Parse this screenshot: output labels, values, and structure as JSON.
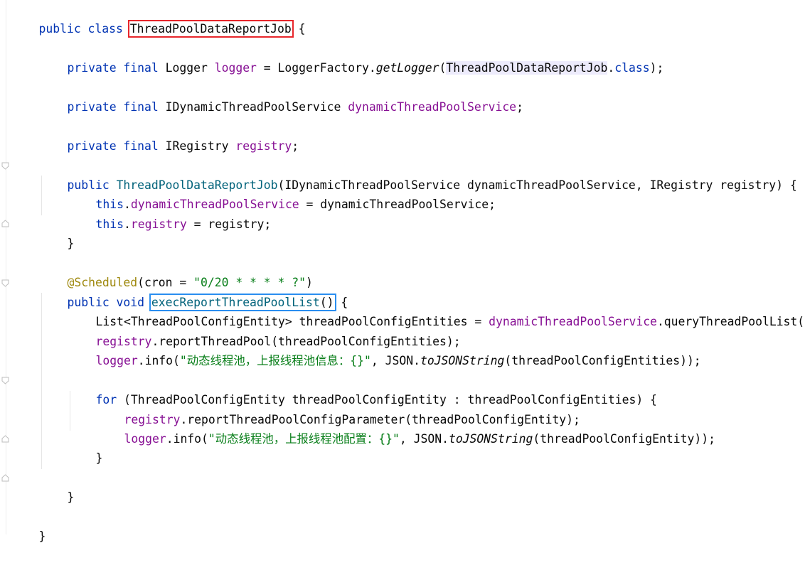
{
  "colors": {
    "keyword": "#0033b3",
    "field": "#871094",
    "string": "#067d17",
    "annotation": "#9e880d",
    "highlight_red": "#e8262b",
    "highlight_blue": "#2a8ef0"
  },
  "code": {
    "l1": {
      "kw": "public class ",
      "cls": "ThreadPoolDataReportJob",
      "rest": " {"
    },
    "l2": {
      "kw": "private final ",
      "t": "Logger ",
      "fld": "logger",
      "a": " = LoggerFactory.",
      "m": "getLogger",
      "b": "(",
      "ref": "ThreadPoolDataReportJob",
      "c": ".",
      "kw2": "class",
      "d": ");"
    },
    "l3": {
      "kw": "private final ",
      "t": "IDynamicThreadPoolService ",
      "fld": "dynamicThreadPoolService",
      "rest": ";"
    },
    "l4": {
      "kw": "private final ",
      "t": "IRegistry ",
      "fld": "registry",
      "rest": ";"
    },
    "l5": {
      "kw": "public ",
      "ctor": "ThreadPoolDataReportJob",
      "rest": "(IDynamicThreadPoolService dynamicThreadPoolService, IRegistry registry) {"
    },
    "l6": {
      "kw": "this",
      "a": ".",
      "fld": "dynamicThreadPoolService",
      "rest": " = dynamicThreadPoolService;"
    },
    "l7": {
      "kw": "this",
      "a": ".",
      "fld": "registry",
      "rest": " = registry;"
    },
    "l8": {
      "rest": "}"
    },
    "l9": {
      "ann": "@Scheduled",
      "a": "(cron = ",
      "str": "\"0/20 * * * * ?\"",
      "b": ")"
    },
    "l10": {
      "kw": "public void ",
      "method": "execReportThreadPoolList",
      "paren": "()",
      "rest": " {"
    },
    "l11": {
      "a": "List<ThreadPoolConfigEntity> threadPoolConfigEntities = ",
      "fld": "dynamicThreadPoolService",
      "rest": ".queryThreadPoolList();"
    },
    "l12": {
      "fld": "registry",
      "rest": ".reportThreadPool(threadPoolConfigEntities);"
    },
    "l13": {
      "fld": "logger",
      "a": ".info(",
      "str": "\"动态线程池，上报线程池信息：{}\"",
      "b": ", JSON.",
      "m": "toJSONString",
      "rest": "(threadPoolConfigEntities));"
    },
    "l14": {
      "kw": "for",
      "rest": " (ThreadPoolConfigEntity threadPoolConfigEntity : threadPoolConfigEntities) {"
    },
    "l15": {
      "fld": "registry",
      "rest": ".reportThreadPoolConfigParameter(threadPoolConfigEntity);"
    },
    "l16": {
      "fld": "logger",
      "a": ".info(",
      "str": "\"动态线程池，上报线程池配置：{}\"",
      "b": ", JSON.",
      "m": "toJSONString",
      "rest": "(threadPoolConfigEntity));"
    },
    "l17": {
      "rest": "}"
    },
    "l18": {
      "rest": "}"
    },
    "l19": {
      "rest": "}"
    }
  }
}
